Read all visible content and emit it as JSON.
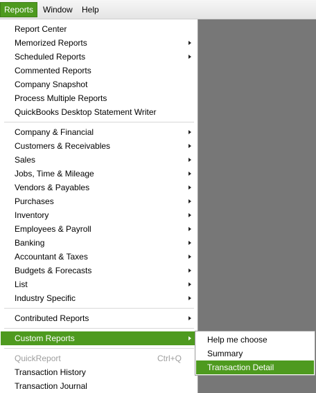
{
  "menubar": {
    "items": [
      {
        "label": "Reports",
        "active": true
      },
      {
        "label": "Window"
      },
      {
        "label": "Help"
      }
    ]
  },
  "reports_menu": {
    "group1": [
      {
        "label": "Report Center"
      },
      {
        "label": "Memorized Reports",
        "submenu": true
      },
      {
        "label": "Scheduled Reports",
        "submenu": true
      },
      {
        "label": "Commented Reports"
      },
      {
        "label": "Company Snapshot"
      },
      {
        "label": "Process Multiple Reports"
      },
      {
        "label": "QuickBooks Desktop Statement Writer"
      }
    ],
    "group2": [
      {
        "label": "Company & Financial",
        "submenu": true
      },
      {
        "label": "Customers & Receivables",
        "submenu": true
      },
      {
        "label": "Sales",
        "submenu": true
      },
      {
        "label": "Jobs, Time & Mileage",
        "submenu": true
      },
      {
        "label": "Vendors & Payables",
        "submenu": true
      },
      {
        "label": "Purchases",
        "submenu": true
      },
      {
        "label": "Inventory",
        "submenu": true
      },
      {
        "label": "Employees & Payroll",
        "submenu": true
      },
      {
        "label": "Banking",
        "submenu": true
      },
      {
        "label": "Accountant & Taxes",
        "submenu": true
      },
      {
        "label": "Budgets & Forecasts",
        "submenu": true
      },
      {
        "label": "List",
        "submenu": true
      },
      {
        "label": "Industry Specific",
        "submenu": true
      }
    ],
    "group3": [
      {
        "label": "Contributed Reports",
        "submenu": true
      }
    ],
    "group4": [
      {
        "label": "Custom Reports",
        "submenu": true,
        "selected": true
      }
    ],
    "group5": [
      {
        "label": "QuickReport",
        "shortcut": "Ctrl+Q",
        "disabled": true
      },
      {
        "label": "Transaction History"
      },
      {
        "label": "Transaction Journal"
      }
    ]
  },
  "custom_reports_submenu": [
    {
      "label": "Help me choose"
    },
    {
      "label": "Summary"
    },
    {
      "label": "Transaction Detail",
      "selected": true
    }
  ],
  "colors": {
    "accent": "#4e9a1f",
    "workspace": "#777777",
    "disabled_text": "#9e9e9e"
  }
}
